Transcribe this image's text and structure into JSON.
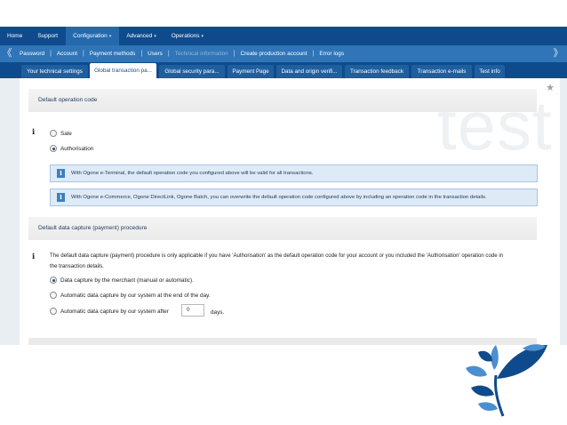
{
  "top_menu": [
    {
      "label": "Home",
      "dropdown": false
    },
    {
      "label": "Support",
      "dropdown": false
    },
    {
      "label": "Configuration",
      "dropdown": true,
      "active": true
    },
    {
      "label": "Advanced",
      "dropdown": true
    },
    {
      "label": "Operations",
      "dropdown": true
    }
  ],
  "caret": "▾",
  "sub_menu": [
    {
      "label": "Password",
      "disabled": false
    },
    {
      "label": "Account",
      "disabled": false
    },
    {
      "label": "Payment methods",
      "disabled": false
    },
    {
      "label": "Users",
      "disabled": false
    },
    {
      "label": "Technical information",
      "disabled": true
    },
    {
      "label": "Create production account",
      "disabled": false
    },
    {
      "label": "Error logs",
      "disabled": false
    }
  ],
  "sub_arrow_left": "《",
  "sub_arrow_right": "》",
  "tabs": [
    {
      "label": "Your technical settings"
    },
    {
      "label": "Global transaction pa...",
      "active": true
    },
    {
      "label": "Global security para..."
    },
    {
      "label": "Payment Page"
    },
    {
      "label": "Data and origin verifi..."
    },
    {
      "label": "Transaction feedback"
    },
    {
      "label": "Transaction e-mails"
    },
    {
      "label": "Test info"
    }
  ],
  "watermark": "test",
  "section1": {
    "title": "Default operation code",
    "options": [
      {
        "label": "Sale",
        "selected": false
      },
      {
        "label": "Authorisation",
        "selected": true
      }
    ],
    "info_boxes": [
      "With Ogone e-Terminal, the default operation code you configured above will be valid for all transactions.",
      "With Ogone e-Commerce, Ogone DirectLink, Ogone Batch, you can overwrite the default operation code configured above by including an operation code in the transaction details."
    ]
  },
  "section2": {
    "title": "Default data capture (payment) procedure",
    "paragraph_line1": "The default data capture (payment) procedure is only applicable if you have 'Authorisation' as the default operation code for your account or you included the 'Authorisation' operation code in",
    "paragraph_line2": "the transaction details.",
    "options": [
      {
        "label": "Data capture by the merchant (manual or automatic).",
        "selected": true
      },
      {
        "label": "Automatic data capture by our system at the end of the day.",
        "selected": false
      },
      {
        "label": "Automatic data capture by our system after",
        "selected": false
      }
    ],
    "days_value": "0",
    "days_unit": "days."
  },
  "info_icon": "i",
  "colors": {
    "top_bar": "#0f4b8c",
    "sub_bar": "#2f75b7",
    "info_box_bg": "#dfeaf7",
    "logo_dark": "#0f4b8c",
    "logo_light": "#4a8fd0"
  }
}
